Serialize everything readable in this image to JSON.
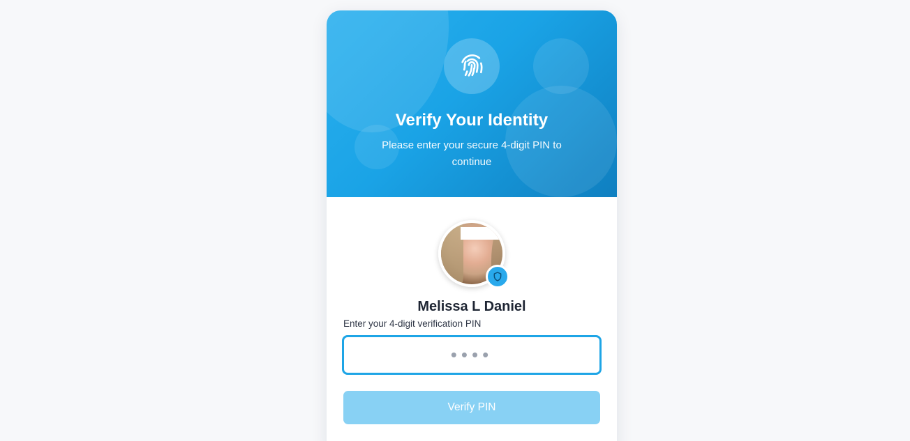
{
  "hero": {
    "title": "Verify Your Identity",
    "subtitle": "Please enter your secure 4-digit PIN to continue",
    "icon": "fingerprint-icon"
  },
  "user": {
    "name": "Melissa L Daniel",
    "badge_icon": "shield-icon"
  },
  "pin": {
    "label": "Enter your 4-digit verification PIN",
    "placeholder": "••••",
    "value": ""
  },
  "actions": {
    "verify_label": "Verify PIN"
  },
  "colors": {
    "accent": "#1ea5e6",
    "button_disabled": "#88d1f4",
    "page_background": "#f7f8fa"
  }
}
